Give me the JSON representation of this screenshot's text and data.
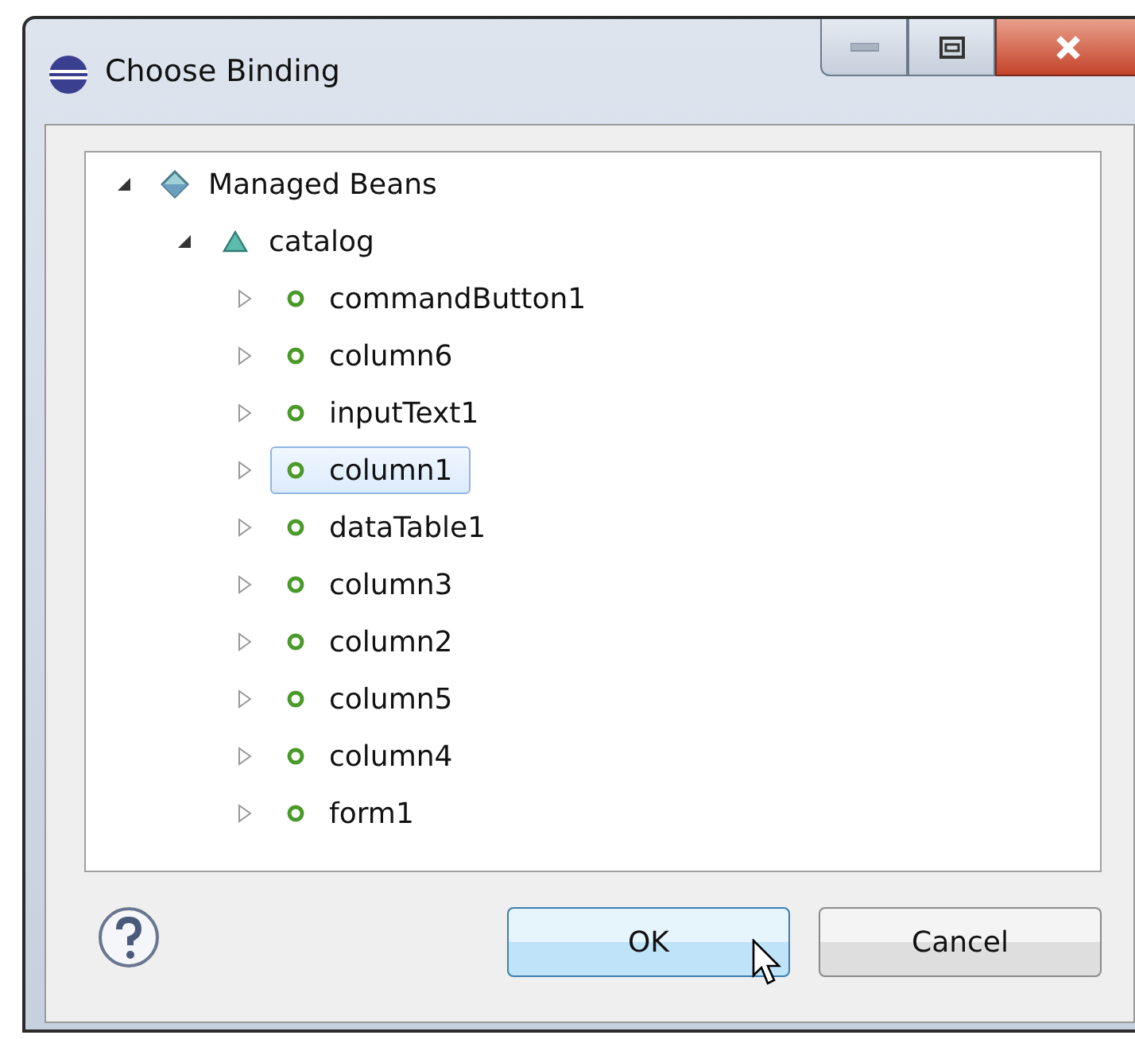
{
  "window": {
    "title": "Choose Binding"
  },
  "tree": [
    {
      "label": "Managed Beans",
      "kind": "root",
      "expanded": true,
      "selected": false,
      "children": [
        {
          "label": "catalog",
          "kind": "bean",
          "expanded": true,
          "selected": false,
          "children": [
            {
              "label": "commandButton1",
              "kind": "property",
              "expanded": false,
              "selected": false
            },
            {
              "label": "column6",
              "kind": "property",
              "expanded": false,
              "selected": false
            },
            {
              "label": "inputText1",
              "kind": "property",
              "expanded": false,
              "selected": false
            },
            {
              "label": "column1",
              "kind": "property",
              "expanded": false,
              "selected": true
            },
            {
              "label": "dataTable1",
              "kind": "property",
              "expanded": false,
              "selected": false
            },
            {
              "label": "column3",
              "kind": "property",
              "expanded": false,
              "selected": false
            },
            {
              "label": "column2",
              "kind": "property",
              "expanded": false,
              "selected": false
            },
            {
              "label": "column5",
              "kind": "property",
              "expanded": false,
              "selected": false
            },
            {
              "label": "column4",
              "kind": "property",
              "expanded": false,
              "selected": false
            },
            {
              "label": "form1",
              "kind": "property",
              "expanded": false,
              "selected": false
            }
          ]
        }
      ]
    }
  ],
  "buttons": [
    {
      "label": "OK",
      "hovered": true
    },
    {
      "label": "Cancel",
      "hovered": false
    }
  ]
}
